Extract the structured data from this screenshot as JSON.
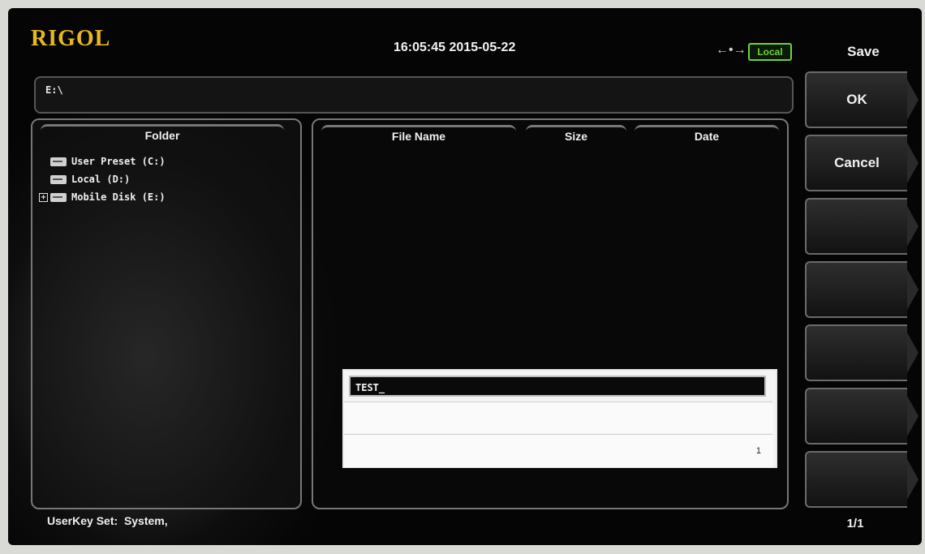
{
  "header": {
    "brand": "RIGOL",
    "datetime": "16:05:45 2015-05-22",
    "status_badge": "Local",
    "usb_symbol": "←•→",
    "icons": [
      "usb-icon"
    ]
  },
  "path": {
    "current": "E:\\"
  },
  "folder_panel": {
    "title": "Folder",
    "items": [
      {
        "label": "User Preset (C:)",
        "expandable": false
      },
      {
        "label": "Local (D:)",
        "expandable": false
      },
      {
        "label": "Mobile Disk (E:)",
        "expandable": true
      }
    ]
  },
  "file_panel": {
    "columns": [
      "File Name",
      "Size",
      "Date"
    ],
    "files": []
  },
  "name_input": {
    "value": "TEST_",
    "page_number": "1"
  },
  "footer": {
    "userkey_label": "UserKey Set:",
    "userkey_value": "System,"
  },
  "menu": {
    "title": "Save",
    "buttons": [
      "OK",
      "Cancel",
      "",
      "",
      "",
      "",
      ""
    ],
    "pager": "1/1"
  },
  "colors": {
    "brand": "#e8b91c",
    "local_badge": "#6fd23d",
    "screen_bg": "#050505"
  }
}
